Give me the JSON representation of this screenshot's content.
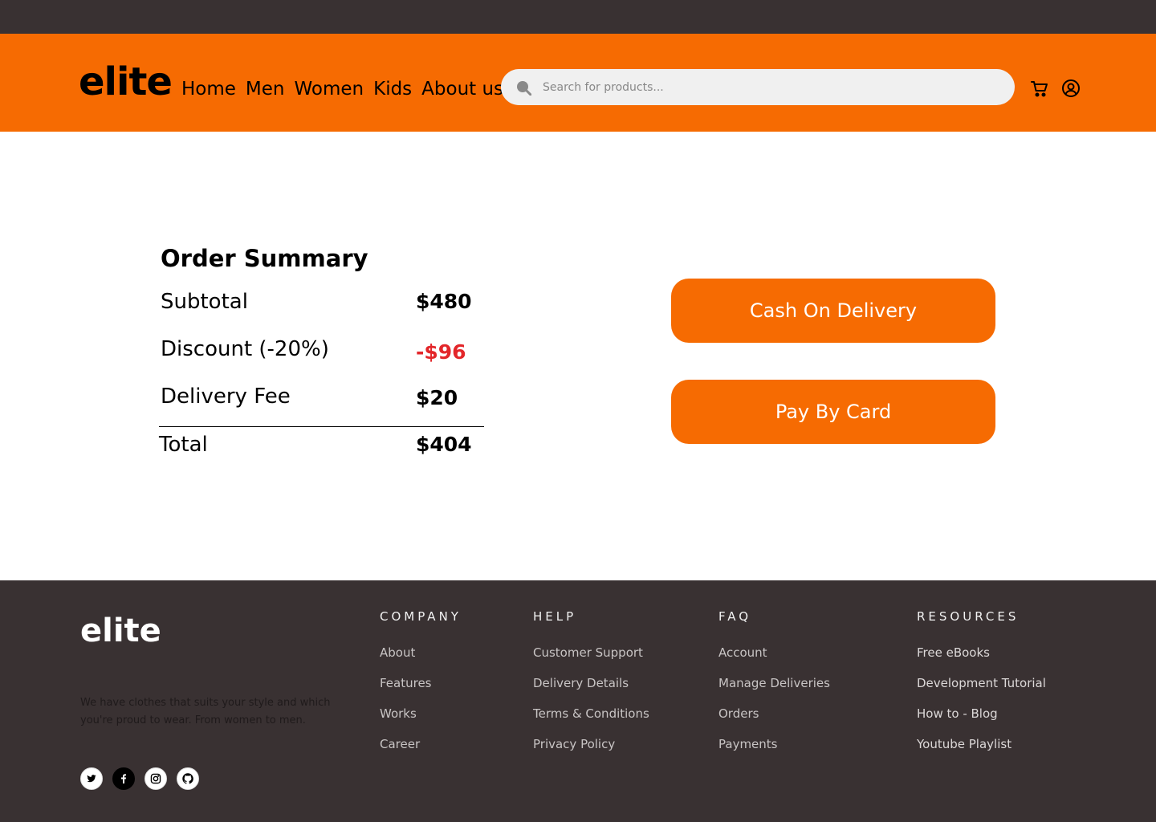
{
  "header": {
    "logo": "elite",
    "nav": [
      "Home",
      "Men",
      "Women",
      "Kids",
      "About us"
    ],
    "search_placeholder": "Search for products...",
    "icons": [
      "search-icon",
      "cart-icon",
      "user-icon"
    ]
  },
  "order_summary": {
    "title": "Order Summary",
    "rows": [
      {
        "label": "Subtotal",
        "value": "$480"
      },
      {
        "label": "Discount (-20%)",
        "value": "-$96"
      },
      {
        "label": "Delivery Fee",
        "value": "$20"
      },
      {
        "label": "Total",
        "value": "$404"
      }
    ]
  },
  "payment": {
    "cash_label": "Cash On Delivery",
    "card_label": "Pay By Card"
  },
  "colors": {
    "accent": "#f66b02",
    "dark": "#393132",
    "discount": "#e3262a"
  },
  "footer": {
    "logo": "elite",
    "description": "We have clothes that suits your style and which you're proud to wear. From women to men.",
    "socials": [
      "twitter-icon",
      "facebook-icon",
      "instagram-icon",
      "github-icon"
    ],
    "columns": [
      {
        "title": "COMPANY",
        "links": [
          "About",
          "Features",
          "Works",
          "Career"
        ]
      },
      {
        "title": "HELP",
        "links": [
          "Customer Support",
          "Delivery Details",
          "Terms & Conditions",
          "Privacy Policy"
        ]
      },
      {
        "title": "FAQ",
        "links": [
          "Account",
          "Manage Deliveries",
          "Orders",
          "Payments"
        ]
      },
      {
        "title": "RESOURCES",
        "links": [
          "Free eBooks",
          "Development Tutorial",
          "How to - Blog",
          "Youtube Playlist"
        ]
      }
    ]
  }
}
